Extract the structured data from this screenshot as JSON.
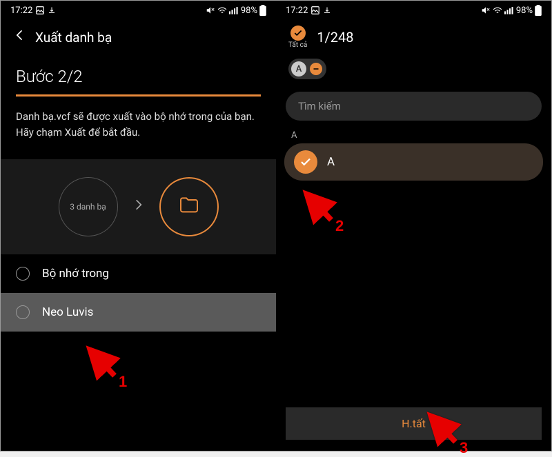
{
  "status": {
    "time": "17:22",
    "battery": "98%"
  },
  "screen1": {
    "title": "Xuất danh bạ",
    "step": "Bước 2/2",
    "instruction": "Danh bạ.vcf sẽ được xuất vào bộ nhớ trong của bạn. Hãy chạm Xuất để bắt đầu.",
    "circle_label": "3 danh bạ",
    "option1": "Bộ nhớ trong",
    "option2": "Neo Luvis"
  },
  "screen2": {
    "select_all": "Tất cả",
    "counter": "1/248",
    "chip_letter": "A",
    "search_placeholder": "Tìm kiếm",
    "section": "A",
    "contact": "A",
    "done": "H.tất"
  },
  "annotations": {
    "n1": "1",
    "n2": "2",
    "n3": "3"
  }
}
